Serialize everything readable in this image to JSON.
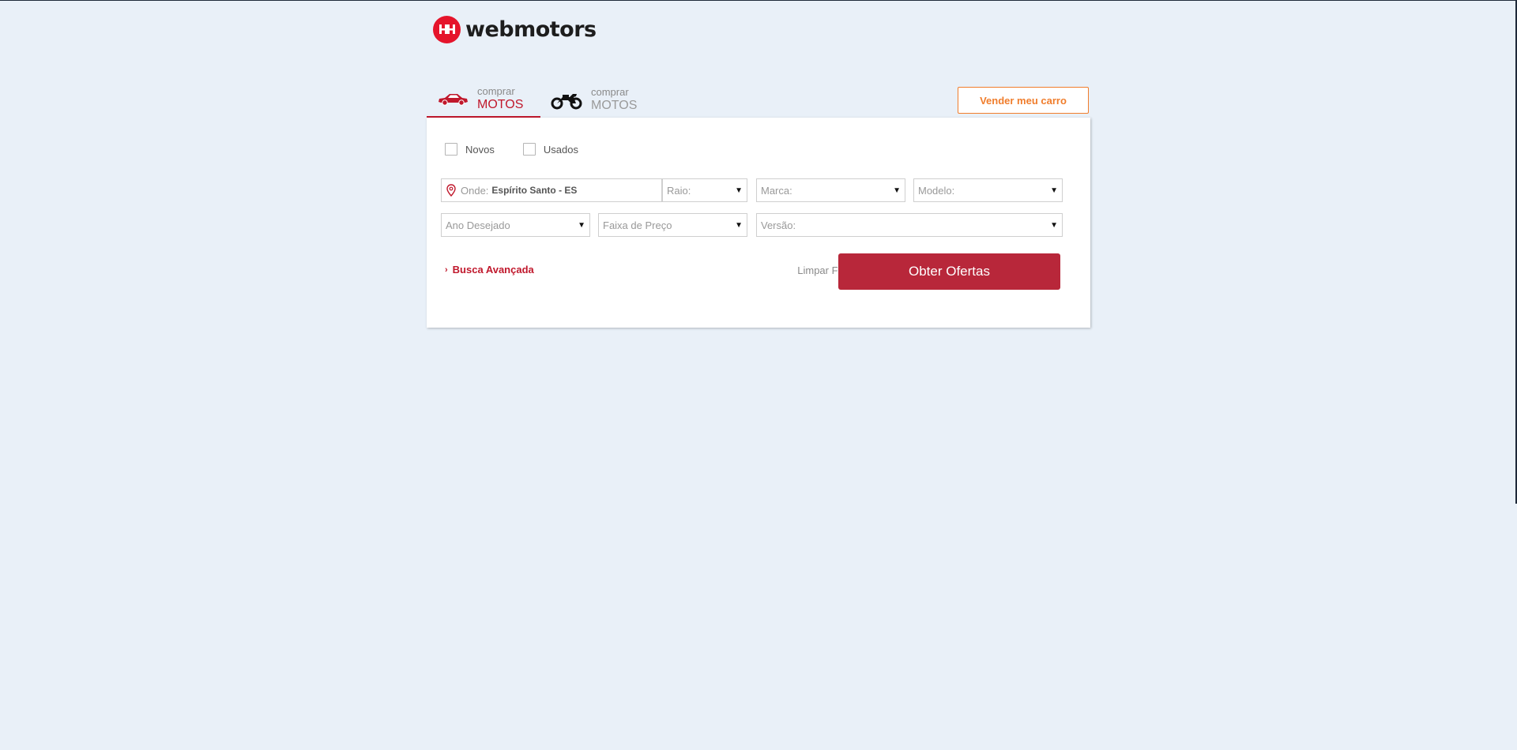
{
  "brand": {
    "name": "webmotors",
    "color": "#e5142b"
  },
  "tabs": [
    {
      "small": "comprar",
      "label": "MOTOS",
      "icon": "car-icon",
      "active": true
    },
    {
      "small": "comprar",
      "label": "MOTOS",
      "icon": "motorcycle-icon",
      "active": false
    }
  ],
  "sell_button": {
    "label": "Vender meu carro",
    "color": "#f07d2c"
  },
  "filters": {
    "condition": [
      {
        "label": "Novos",
        "checked": false
      },
      {
        "label": "Usados",
        "checked": false
      }
    ],
    "where": {
      "label": "Onde:",
      "value": "Espírito Santo - ES",
      "icon": "location-pin-icon"
    },
    "raio": {
      "label": "Raio:"
    },
    "marca": {
      "label": "Marca:"
    },
    "modelo": {
      "label": "Modelo:"
    },
    "ano": {
      "label": "Ano Desejado"
    },
    "faixa": {
      "label": "Faixa de Preço"
    },
    "versao": {
      "label": "Versão:"
    }
  },
  "actions": {
    "advanced_label": "Busca Avançada",
    "clear_label": "Limpar Filtros",
    "submit_label": "Obter Ofertas",
    "submit_color": "#b8273a"
  }
}
